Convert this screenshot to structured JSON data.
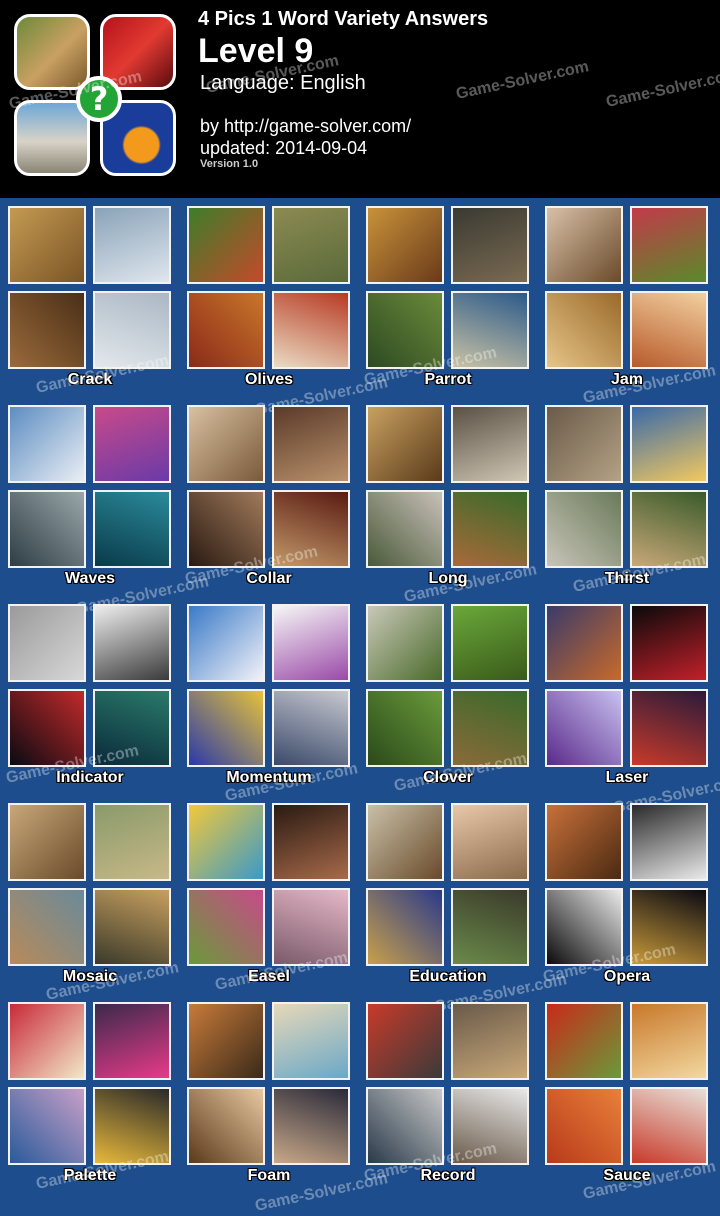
{
  "header": {
    "title": "4 Pics 1 Word Variety Answers",
    "level": "Level 9",
    "language": "Language: English",
    "by": "by http://game-solver.com/",
    "updated": "updated: 2014-09-04",
    "version": "Version 1.0",
    "logo_badge": "?"
  },
  "watermark": "Game-Solver.com",
  "colors": {
    "background": "#1d4d8c",
    "header": "#000000",
    "badge": "#22a535"
  },
  "puzzles": [
    {
      "answer": "Crack"
    },
    {
      "answer": "Olives"
    },
    {
      "answer": "Parrot"
    },
    {
      "answer": "Jam"
    },
    {
      "answer": "Waves"
    },
    {
      "answer": "Collar"
    },
    {
      "answer": "Long"
    },
    {
      "answer": "Thirst"
    },
    {
      "answer": "Indicator"
    },
    {
      "answer": "Momentum"
    },
    {
      "answer": "Clover"
    },
    {
      "answer": "Laser"
    },
    {
      "answer": "Mosaic"
    },
    {
      "answer": "Easel"
    },
    {
      "answer": "Education"
    },
    {
      "answer": "Opera"
    },
    {
      "answer": "Palette"
    },
    {
      "answer": "Foam"
    },
    {
      "answer": "Record"
    },
    {
      "answer": "Sauce"
    }
  ]
}
